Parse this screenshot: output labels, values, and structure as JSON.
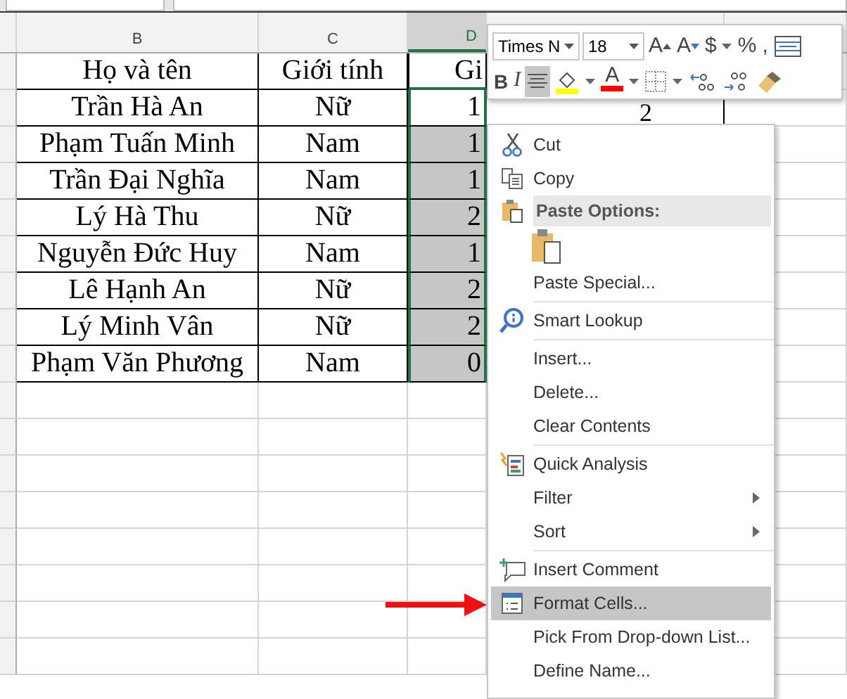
{
  "columns": [
    {
      "label": "B",
      "selected": false
    },
    {
      "label": "C",
      "selected": false
    },
    {
      "label": "D",
      "selected": true
    }
  ],
  "header_row": {
    "name": "Họ và tên",
    "gender": "Giới tính",
    "col_d": "Gi"
  },
  "rows": [
    {
      "name": "Trần Hà An",
      "gender": "Nữ",
      "col_d": "1",
      "col_e": "2",
      "selected": false
    },
    {
      "name": "Phạm Tuấn Minh",
      "gender": "Nam",
      "col_d": "1",
      "selected": true
    },
    {
      "name": "Trần Đại Nghĩa",
      "gender": "Nam",
      "col_d": "1",
      "selected": true
    },
    {
      "name": "Lý Hà Thu",
      "gender": "Nữ",
      "col_d": "2",
      "selected": true
    },
    {
      "name": "Nguyễn Đức Huy",
      "gender": "Nam",
      "col_d": "1",
      "selected": true
    },
    {
      "name": "Lê Hạnh An",
      "gender": "Nữ",
      "col_d": "2",
      "selected": true
    },
    {
      "name": "Lý Minh Vân",
      "gender": "Nữ",
      "col_d": "2",
      "selected": true
    },
    {
      "name": "Phạm Văn Phương",
      "gender": "Nam",
      "col_d": "0",
      "selected": true
    }
  ],
  "mini_toolbar": {
    "font": "Times N",
    "size": "18",
    "row_1": [
      {
        "kind": "grow",
        "label": "A"
      },
      {
        "kind": "shrink",
        "label": "A"
      },
      {
        "kind": "text",
        "label": "$"
      },
      {
        "kind": "caret"
      },
      {
        "kind": "text",
        "label": "%"
      },
      {
        "kind": "text",
        "label": ","
      },
      {
        "kind": "merge"
      }
    ],
    "row_2": [
      {
        "kind": "text",
        "label": "B",
        "selected": false
      },
      {
        "kind": "italic",
        "label": "I",
        "selected": false
      },
      {
        "kind": "align",
        "selected": true
      },
      {
        "kind": "fill",
        "color": "#ffff00",
        "selected": false
      },
      {
        "kind": "caret",
        "selected": false
      },
      {
        "kind": "fontcolor",
        "label": "A",
        "color": "#ff0000",
        "selected": false
      },
      {
        "kind": "caret",
        "selected": false
      },
      {
        "kind": "borders",
        "selected": false
      },
      {
        "kind": "caret",
        "selected": false
      },
      {
        "kind": "incdec",
        "selected": false
      },
      {
        "kind": "decdec",
        "selected": false
      },
      {
        "kind": "painter",
        "selected": false
      }
    ]
  },
  "context_menu": [
    {
      "kind": "item",
      "label": "Cut",
      "selected": false
    },
    {
      "kind": "item",
      "label": "Copy",
      "selected": false
    },
    {
      "kind": "header",
      "label": "Paste Options:"
    },
    {
      "kind": "paste"
    },
    {
      "kind": "item",
      "label": "Paste Special...",
      "selected": false
    },
    {
      "kind": "separator"
    },
    {
      "kind": "item",
      "label": "Smart Lookup",
      "selected": false
    },
    {
      "kind": "separator"
    },
    {
      "kind": "item",
      "label": "Insert...",
      "selected": false
    },
    {
      "kind": "item",
      "label": "Delete...",
      "selected": false
    },
    {
      "kind": "item",
      "label": "Clear Contents",
      "selected": false
    },
    {
      "kind": "separator"
    },
    {
      "kind": "item",
      "label": "Quick Analysis",
      "selected": false
    },
    {
      "kind": "item",
      "label": "Filter",
      "selected": false,
      "submenu": true
    },
    {
      "kind": "item",
      "label": "Sort",
      "selected": false,
      "submenu": true
    },
    {
      "kind": "separator"
    },
    {
      "kind": "item",
      "label": "Insert Comment",
      "selected": false
    },
    {
      "kind": "item",
      "label": "Format Cells...",
      "selected": true
    },
    {
      "kind": "item",
      "label": "Pick From Drop-down List...",
      "selected": false
    },
    {
      "kind": "item",
      "label": "Define Name...",
      "selected": false
    }
  ]
}
